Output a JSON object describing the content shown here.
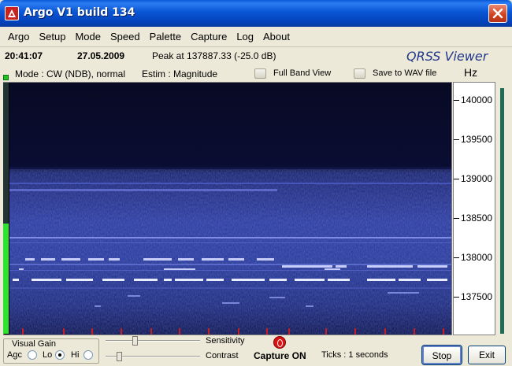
{
  "window": {
    "title": "Argo V1 build 134"
  },
  "menu": [
    "Argo",
    "Setup",
    "Mode",
    "Speed",
    "Palette",
    "Capture",
    "Log",
    "About"
  ],
  "info": {
    "time": "20:41:07",
    "date": "27.05.2009",
    "peak": "Peak at 137887.33 (-25.0 dB)",
    "logo": "QRSS Viewer"
  },
  "mode": {
    "mode_text": "Mode : CW (NDB), normal",
    "estim_text": "Estim : Magnitude",
    "full_band_view": "Full Band View",
    "save_to_wav": "Save to WAV file",
    "unit": "Hz"
  },
  "axis": {
    "labels": [
      "140000",
      "139500",
      "139000",
      "138500",
      "138000",
      "137500"
    ]
  },
  "signal_level": 0.44,
  "controls": {
    "visual_gain_title": "Visual Gain",
    "agc_label": "Agc",
    "lo_label": "Lo",
    "hi_label": "Hi",
    "selected_gain": "Lo",
    "sensitivity_label": "Sensitivity",
    "contrast_label": "Contrast",
    "capture_status": "Capture ON",
    "ticks_text": "Ticks   : 1 seconds",
    "stop_label": "Stop",
    "exit_label": "Exit"
  },
  "colors": {
    "accent": "#0a55d4",
    "led": "#1ec51e",
    "record": "#d91414",
    "tick": "#c81e1e"
  }
}
